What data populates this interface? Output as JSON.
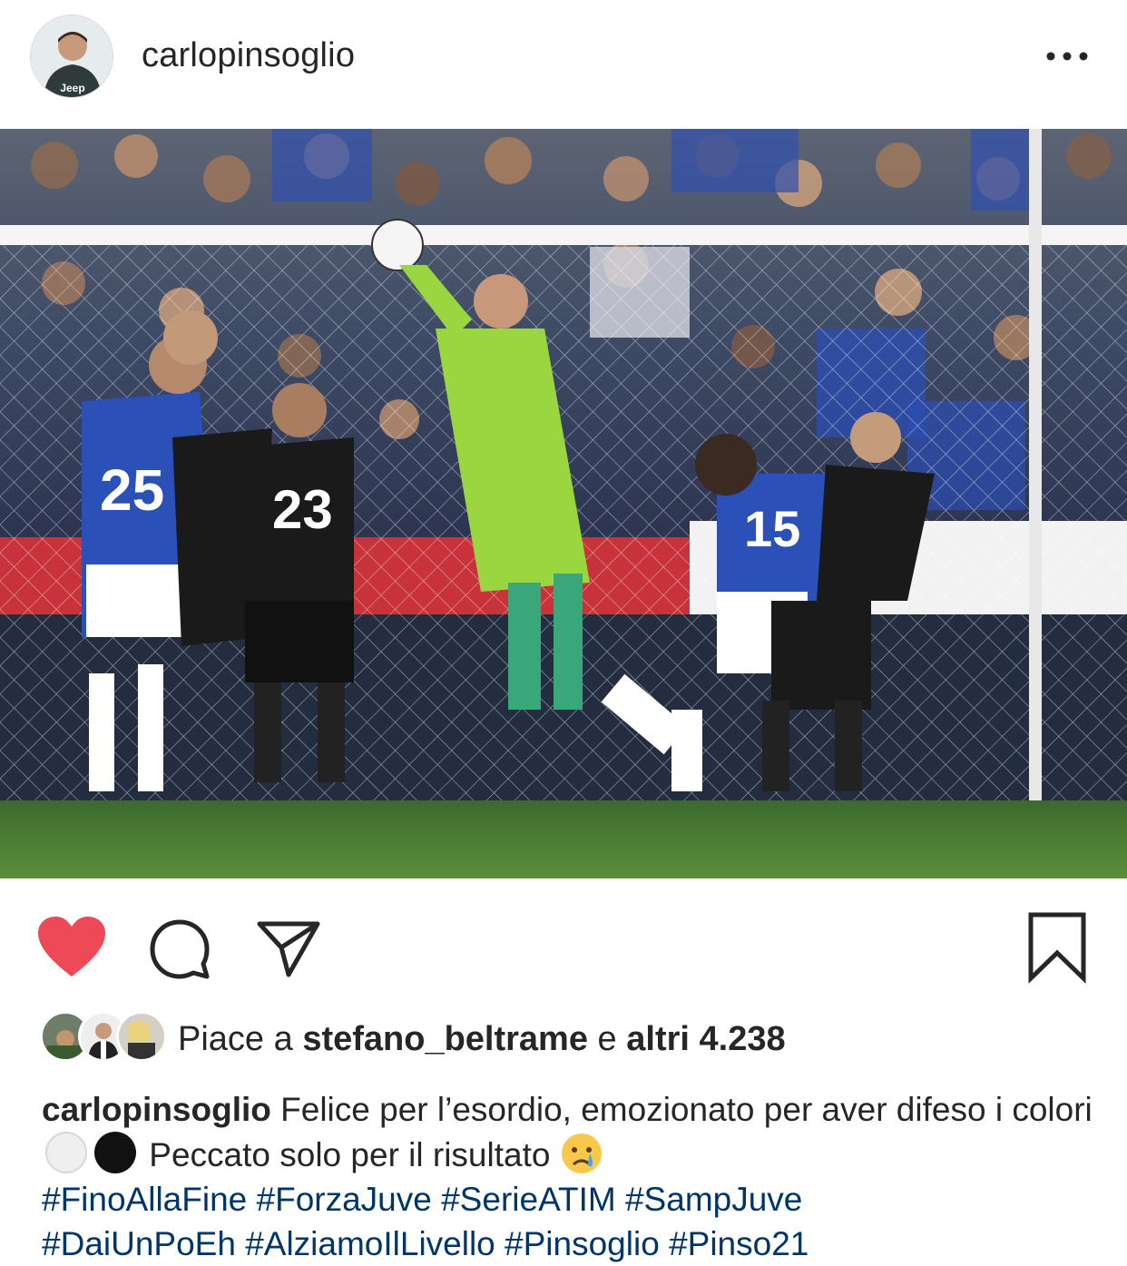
{
  "post": {
    "author": "carlopinsoglio",
    "avatar_icon": "avatar-goalkeeper",
    "more_icon": "more-horizontal-icon"
  },
  "photo": {
    "description_icon": "post-photo"
  },
  "actions": {
    "like_icon": "heart-filled-icon",
    "comment_icon": "comment-icon",
    "share_icon": "paper-plane-icon",
    "save_icon": "bookmark-icon",
    "like_color": "#ed4956"
  },
  "likes": {
    "prefix": "Piace a",
    "user": "stefano_beltrame",
    "middle": "e",
    "count": "altri 4.238"
  },
  "caption": {
    "author": "carlopinsoglio",
    "text1": "Felice per l’esordio, emozionato per aver difeso i colori",
    "text2": "Peccato solo per il risultato",
    "emoji_white": "⚪",
    "emoji_black": "⚫",
    "emoji_cry": "😢",
    "hashtags": [
      "#FinoAllaFine",
      "#ForzaJuve",
      "#SerieATIM",
      "#SampJuve",
      "#DaiUnPoEh",
      "#AlziamoIlLivello",
      "#Pinsoglio",
      "#Pinso21"
    ]
  }
}
